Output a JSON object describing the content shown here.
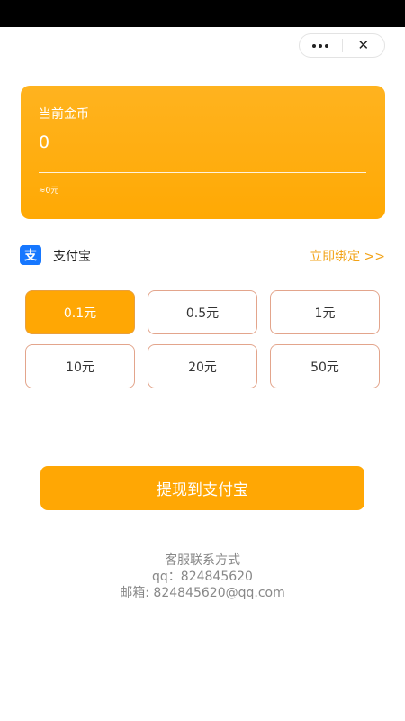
{
  "nav": {
    "more_label": "more",
    "close_symbol": "✕"
  },
  "coin_card": {
    "label": "当前金币",
    "value": "0",
    "approx": "≈0元",
    "colors": {
      "start": "#ffb31f",
      "end": "#ffa904"
    }
  },
  "payment": {
    "logo_glyph": "支",
    "name": "支付宝",
    "bind_link": "立即绑定 >>",
    "colors": {
      "logo": "#1677ff",
      "link": "#f2a216"
    }
  },
  "amounts": {
    "options": [
      "0.1元",
      "0.5元",
      "1元",
      "10元",
      "20元",
      "50元"
    ],
    "selected_index": 0,
    "colors": {
      "selected_bg": "#ffa704",
      "border": "#e3a58c"
    }
  },
  "withdraw_button": {
    "label": "提现到支付宝",
    "color": "#ffa704"
  },
  "contact": {
    "title": "客服联系方式",
    "qq": "qq：824845620",
    "email": "邮箱: 824845620@qq.com"
  }
}
